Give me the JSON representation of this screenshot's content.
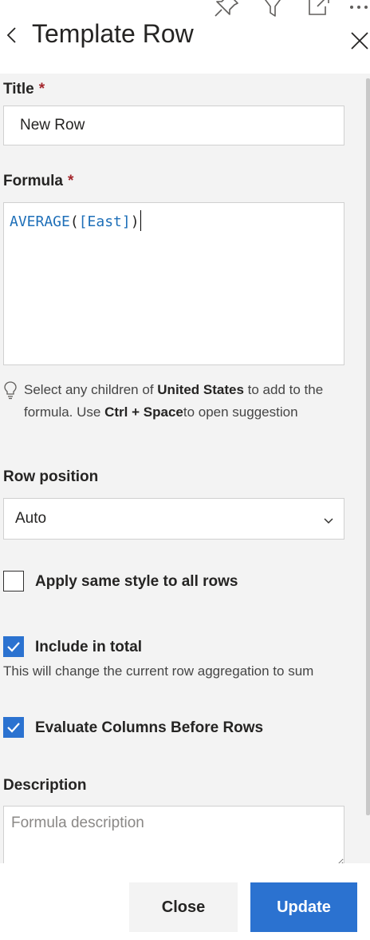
{
  "header": {
    "title": "Template Row",
    "icons": [
      "pin-icon",
      "filter-icon",
      "expand-icon",
      "more-icon"
    ]
  },
  "form": {
    "title_field": {
      "label": "Title",
      "required_mark": "*",
      "value": "New Row"
    },
    "formula_field": {
      "label": "Formula",
      "required_mark": "*",
      "function_name": "AVERAGE",
      "open_paren": "(",
      "reference": "[East]",
      "close_paren": ")"
    },
    "hint": {
      "prefix": "Select any children of",
      "bold1": "United States",
      "middle": "to add to the formula. Use",
      "bold2": "Ctrl + Space",
      "suffix": "to open suggestion"
    },
    "row_position": {
      "label": "Row position",
      "selected": "Auto"
    },
    "apply_style": {
      "label": "Apply same style to all rows",
      "checked": false
    },
    "include_total": {
      "label": "Include in total",
      "checked": true,
      "note": "This will change the current row aggregation to sum"
    },
    "evaluate_columns": {
      "label": "Evaluate Columns Before Rows",
      "checked": true
    },
    "description": {
      "label": "Description",
      "placeholder": "Formula description",
      "value": ""
    }
  },
  "footer": {
    "close_label": "Close",
    "update_label": "Update"
  },
  "colors": {
    "accent": "#2b72d0",
    "required": "#a4262c",
    "panel_bg": "#f3f3f3"
  }
}
